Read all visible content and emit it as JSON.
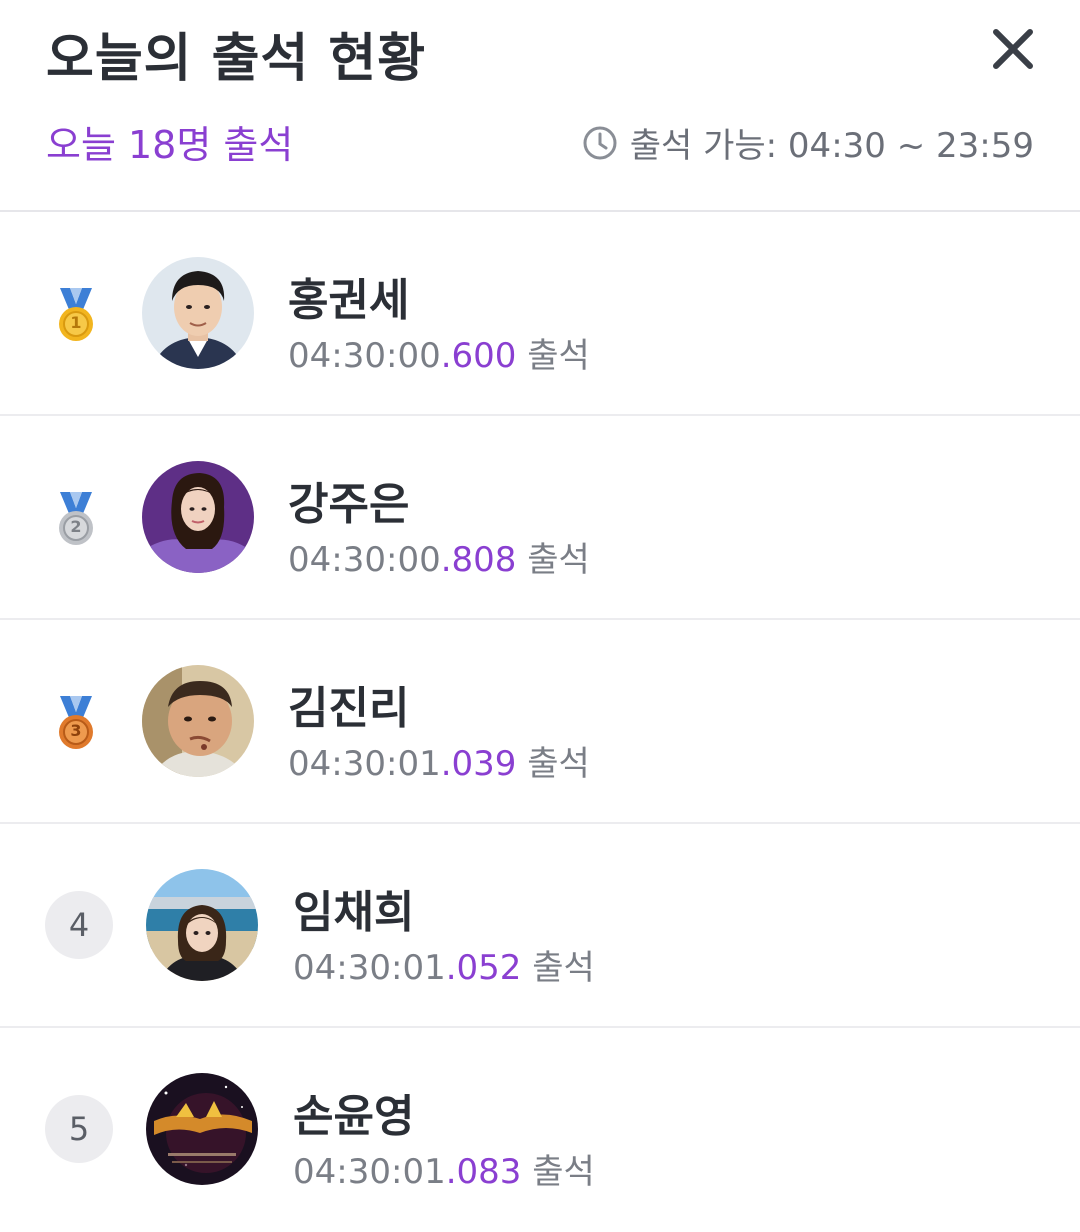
{
  "header": {
    "title": "오늘의 출석 현황",
    "summary": "오늘 18명 출석",
    "hours": "출석 가능: 04:30 ~ 23:59"
  },
  "colors": {
    "accent": "#8a3fd1",
    "text": "#2b2f36",
    "muted": "#7a7e86",
    "divider": "#ececef",
    "gold": "#f2b51f",
    "silver": "#c5c8cc",
    "bronze": "#e58a3a",
    "ribbon": "#3d7fd6"
  },
  "entries": [
    {
      "rank": "1",
      "medal": "gold-medal-icon",
      "name": "홍권세",
      "time_main": "04:30:00",
      "time_ms": ".600",
      "suffix": "출석"
    },
    {
      "rank": "2",
      "medal": "silver-medal-icon",
      "name": "강주은",
      "time_main": "04:30:00",
      "time_ms": ".808",
      "suffix": "출석"
    },
    {
      "rank": "3",
      "medal": "bronze-medal-icon",
      "name": "김진리",
      "time_main": "04:30:01",
      "time_ms": ".039",
      "suffix": "출석"
    },
    {
      "rank": "4",
      "medal": "",
      "name": "임채희",
      "time_main": "04:30:01",
      "time_ms": ".052",
      "suffix": "출석"
    },
    {
      "rank": "5",
      "medal": "",
      "name": "손윤영",
      "time_main": "04:30:01",
      "time_ms": ".083",
      "suffix": "출석"
    }
  ]
}
